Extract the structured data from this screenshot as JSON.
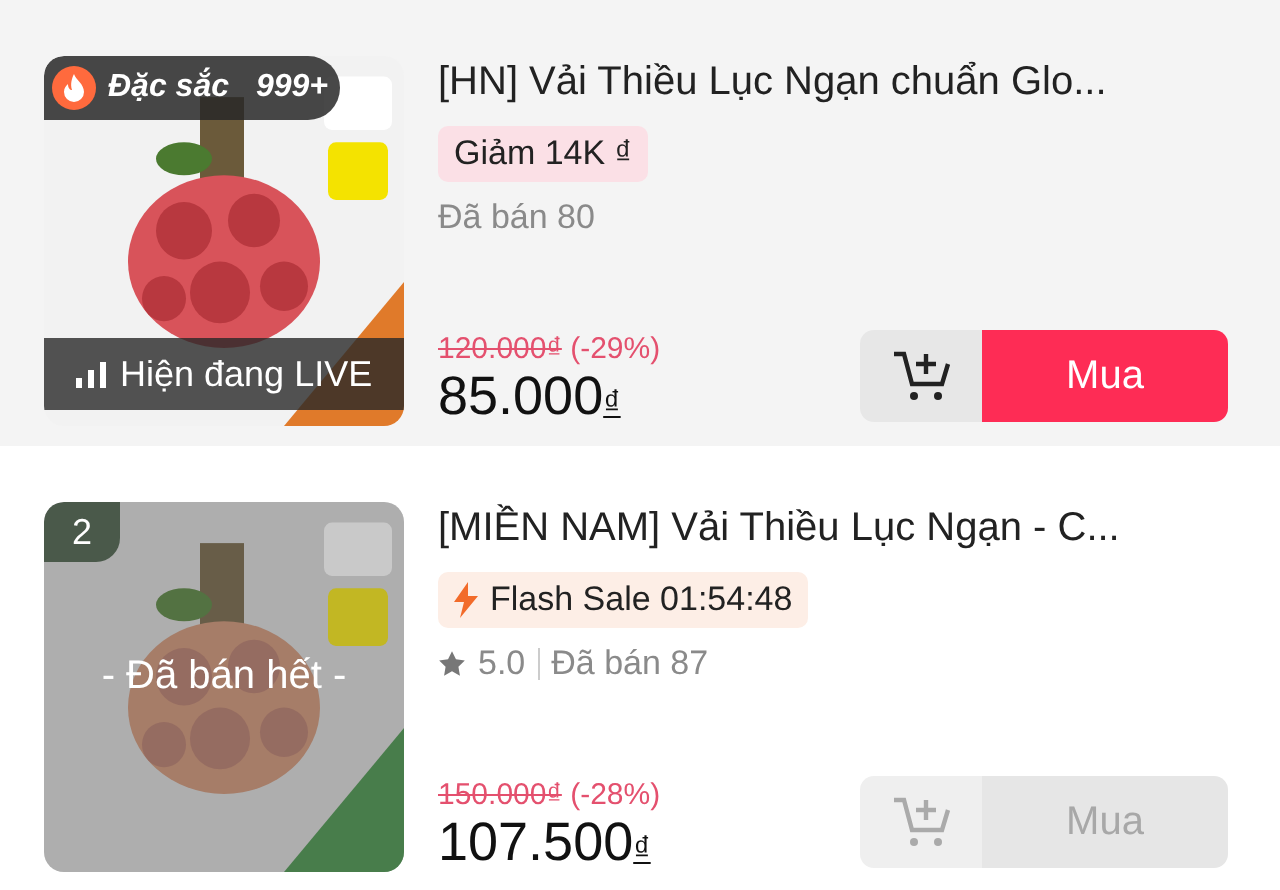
{
  "products": [
    {
      "badge": {
        "label": "Đặc sắc",
        "count": "999+"
      },
      "overlay": {
        "kind": "live",
        "text": "Hiện đang LIVE"
      },
      "title": "[HN] Vải Thiều Lục Ngạn chuẩn Glo...",
      "promo": {
        "kind": "discount",
        "text": "Giảm 14K ₫"
      },
      "sold": "Đã bán 80",
      "old_price": "120.000₫",
      "discount": "(-29%)",
      "price": "85.000",
      "currency": "₫",
      "buy_label": "Mua",
      "disabled": false
    },
    {
      "rank": "2",
      "overlay": {
        "kind": "sold_out",
        "text": "- Đã bán hết -"
      },
      "title": "[MIỀN NAM] Vải Thiều Lục Ngạn - C...",
      "promo": {
        "kind": "flash",
        "text": "Flash Sale 01:54:48"
      },
      "rating": "5.0",
      "sold": "Đã bán 87",
      "old_price": "150.000₫",
      "discount": "(-28%)",
      "price": "107.500",
      "currency": "₫",
      "buy_label": "Mua",
      "disabled": true
    }
  ]
}
